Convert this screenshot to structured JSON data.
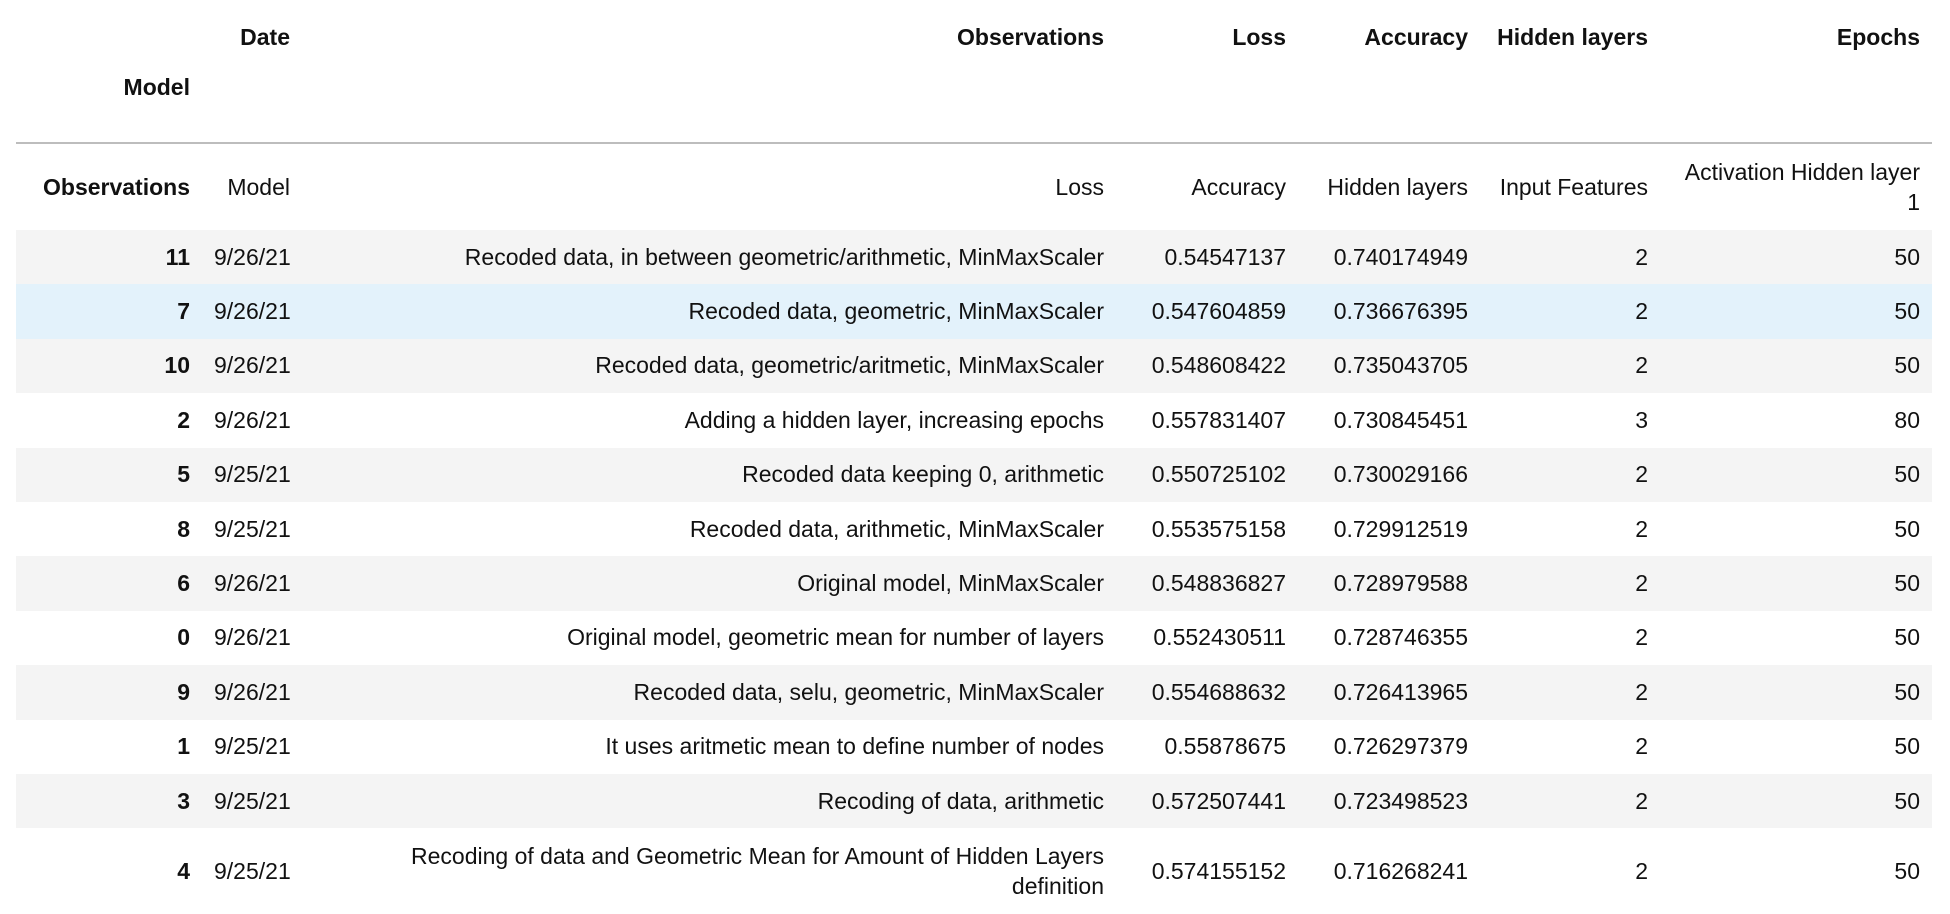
{
  "header_top": {
    "date": "Date",
    "observations": "Observations",
    "loss": "Loss",
    "accuracy": "Accuracy",
    "hidden_layers": "Hidden layers",
    "epochs": "Epochs"
  },
  "header_index_name": "Model",
  "header_mid": {
    "index_name": "Observations",
    "model": "Model",
    "loss": "Loss",
    "accuracy": "Accuracy",
    "hidden_layers": "Hidden layers",
    "input_features": "Input Features",
    "activation": "Activation Hidden layer 1"
  },
  "rows": [
    {
      "idx": "11",
      "date": "9/26/21",
      "obs": "Recoded data, in between geometric/arithmetic, MinMaxScaler",
      "loss": "0.54547137",
      "acc": "0.740174949",
      "hidden": "2",
      "epochs": "50"
    },
    {
      "idx": "7",
      "date": "9/26/21",
      "obs": "Recoded data, geometric, MinMaxScaler",
      "loss": "0.547604859",
      "acc": "0.736676395",
      "hidden": "2",
      "epochs": "50"
    },
    {
      "idx": "10",
      "date": "9/26/21",
      "obs": "Recoded data, geometric/aritmetic, MinMaxScaler",
      "loss": "0.548608422",
      "acc": "0.735043705",
      "hidden": "2",
      "epochs": "50"
    },
    {
      "idx": "2",
      "date": "9/26/21",
      "obs": "Adding a hidden layer, increasing epochs",
      "loss": "0.557831407",
      "acc": "0.730845451",
      "hidden": "3",
      "epochs": "80"
    },
    {
      "idx": "5",
      "date": "9/25/21",
      "obs": "Recoded data keeping 0, arithmetic",
      "loss": "0.550725102",
      "acc": "0.730029166",
      "hidden": "2",
      "epochs": "50"
    },
    {
      "idx": "8",
      "date": "9/25/21",
      "obs": "Recoded data, arithmetic, MinMaxScaler",
      "loss": "0.553575158",
      "acc": "0.729912519",
      "hidden": "2",
      "epochs": "50"
    },
    {
      "idx": "6",
      "date": "9/26/21",
      "obs": "Original model, MinMaxScaler",
      "loss": "0.548836827",
      "acc": "0.728979588",
      "hidden": "2",
      "epochs": "50"
    },
    {
      "idx": "0",
      "date": "9/26/21",
      "obs": "Original model, geometric mean for number of layers",
      "loss": "0.552430511",
      "acc": "0.728746355",
      "hidden": "2",
      "epochs": "50"
    },
    {
      "idx": "9",
      "date": "9/26/21",
      "obs": "Recoded data, selu, geometric, MinMaxScaler",
      "loss": "0.554688632",
      "acc": "0.726413965",
      "hidden": "2",
      "epochs": "50"
    },
    {
      "idx": "1",
      "date": "9/25/21",
      "obs": "It uses aritmetic mean to define number of nodes",
      "loss": "0.55878675",
      "acc": "0.726297379",
      "hidden": "2",
      "epochs": "50"
    },
    {
      "idx": "3",
      "date": "9/25/21",
      "obs": "Recoding of data, arithmetic",
      "loss": "0.572507441",
      "acc": "0.723498523",
      "hidden": "2",
      "epochs": "50"
    },
    {
      "idx": "4",
      "date": "9/25/21",
      "obs": "Recoding of data and Geometric Mean for Amount of Hidden Layers definition",
      "loss": "0.574155152",
      "acc": "0.716268241",
      "hidden": "2",
      "epochs": "50"
    }
  ],
  "hovered_row_index": 1,
  "colors": {
    "stripe": "#f4f4f4",
    "hover": "#e3f2fb",
    "rule": "#bdbdbd"
  }
}
